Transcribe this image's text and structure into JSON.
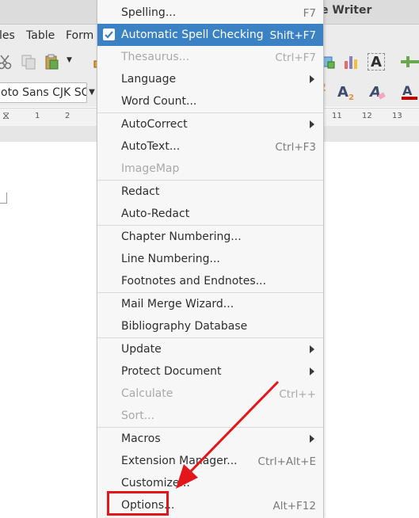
{
  "window": {
    "title": "e Writer"
  },
  "menubar": [
    "les",
    "Table",
    "Form"
  ],
  "toolbar": {
    "font_name": "oto Sans CJK SC"
  },
  "ruler": {
    "ticks": [
      "1",
      "2",
      "11",
      "12",
      "13"
    ]
  },
  "tools_menu": {
    "items": [
      {
        "label": "Spelling...",
        "shortcut": "F7",
        "state": "normal"
      },
      {
        "label": "Automatic Spell Checking",
        "shortcut": "Shift+F7",
        "state": "highlight",
        "checked": true
      },
      {
        "label": "Thesaurus...",
        "shortcut": "Ctrl+F7",
        "state": "disabled"
      },
      {
        "label": "Language",
        "shortcut": "",
        "state": "normal",
        "submenu": true
      },
      {
        "label": "Word Count...",
        "shortcut": "",
        "state": "normal"
      },
      {
        "label": "AutoCorrect",
        "shortcut": "",
        "state": "normal",
        "submenu": true
      },
      {
        "label": "AutoText...",
        "shortcut": "Ctrl+F3",
        "state": "normal"
      },
      {
        "label": "ImageMap",
        "shortcut": "",
        "state": "disabled"
      },
      {
        "label": "Redact",
        "shortcut": "",
        "state": "normal"
      },
      {
        "label": "Auto-Redact",
        "shortcut": "",
        "state": "normal"
      },
      {
        "label": "Chapter Numbering...",
        "shortcut": "",
        "state": "normal"
      },
      {
        "label": "Line Numbering...",
        "shortcut": "",
        "state": "normal"
      },
      {
        "label": "Footnotes and Endnotes...",
        "shortcut": "",
        "state": "normal"
      },
      {
        "label": "Mail Merge Wizard...",
        "shortcut": "",
        "state": "normal"
      },
      {
        "label": "Bibliography Database",
        "shortcut": "",
        "state": "normal"
      },
      {
        "label": "Update",
        "shortcut": "",
        "state": "normal",
        "submenu": true
      },
      {
        "label": "Protect Document",
        "shortcut": "",
        "state": "normal",
        "submenu": true
      },
      {
        "label": "Calculate",
        "shortcut": "Ctrl++",
        "state": "disabled"
      },
      {
        "label": "Sort...",
        "shortcut": "",
        "state": "disabled"
      },
      {
        "label": "Macros",
        "shortcut": "",
        "state": "normal",
        "submenu": true
      },
      {
        "label": "Extension Manager...",
        "shortcut": "Ctrl+Alt+E",
        "state": "normal"
      },
      {
        "label": "Customize...",
        "shortcut": "",
        "state": "normal"
      },
      {
        "label": "Options...",
        "shortcut": "Alt+F12",
        "state": "normal"
      }
    ]
  },
  "colors": {
    "highlight": "#3b82c4",
    "annotation": "#e4161b"
  }
}
